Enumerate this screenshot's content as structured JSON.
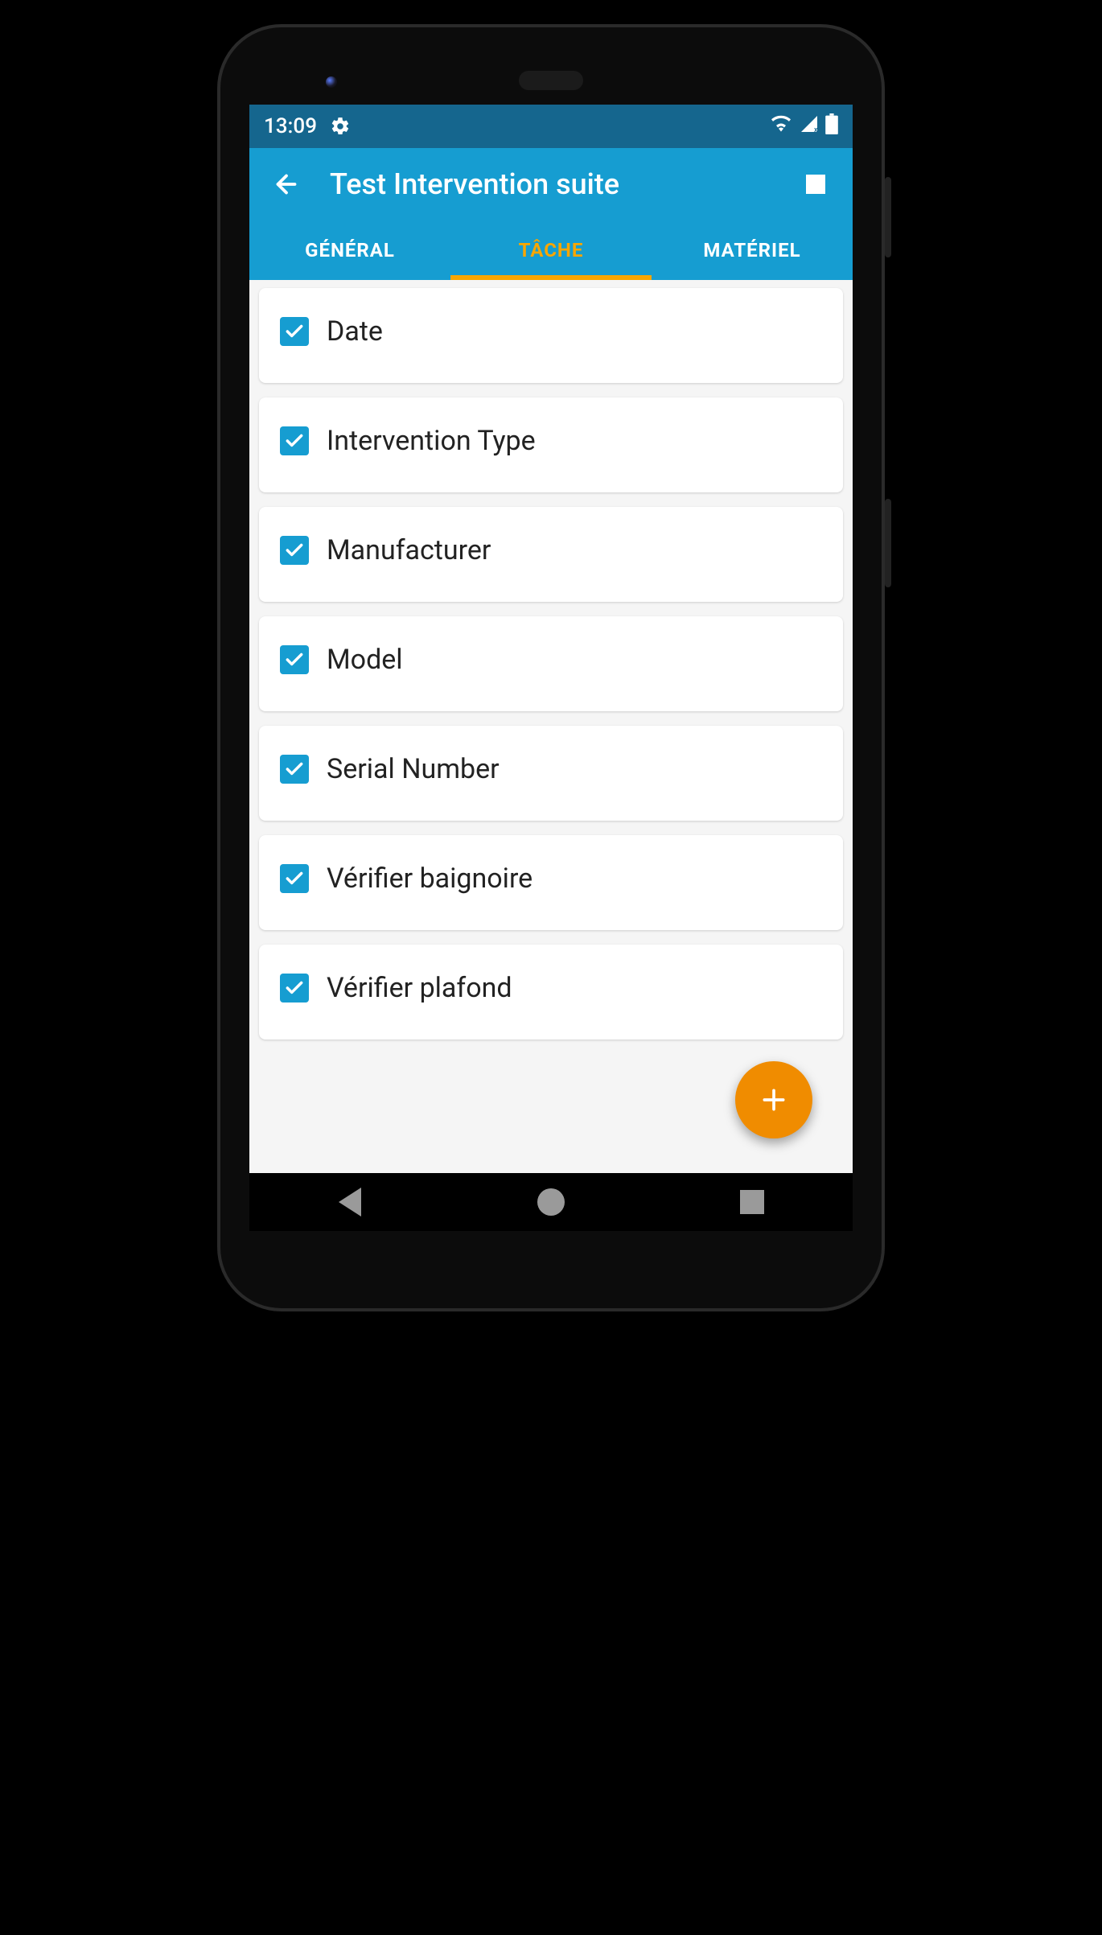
{
  "status": {
    "time": "13:09"
  },
  "appbar": {
    "title": "Test Intervention suite"
  },
  "tabs": [
    {
      "key": "general",
      "label": "GÉNÉRAL",
      "active": false
    },
    {
      "key": "tache",
      "label": "TÂCHE",
      "active": true
    },
    {
      "key": "materiel",
      "label": "MATÉRIEL",
      "active": false
    }
  ],
  "tasks": [
    {
      "label": "Date",
      "checked": true
    },
    {
      "label": "Intervention Type",
      "checked": true
    },
    {
      "label": "Manufacturer",
      "checked": true
    },
    {
      "label": "Model",
      "checked": true
    },
    {
      "label": "Serial Number",
      "checked": true
    },
    {
      "label": "Vérifier baignoire",
      "checked": true
    },
    {
      "label": "Vérifier plafond",
      "checked": true
    }
  ],
  "colors": {
    "primary": "#169dd1",
    "accent": "#f8a600",
    "fab": "#f08c00"
  }
}
